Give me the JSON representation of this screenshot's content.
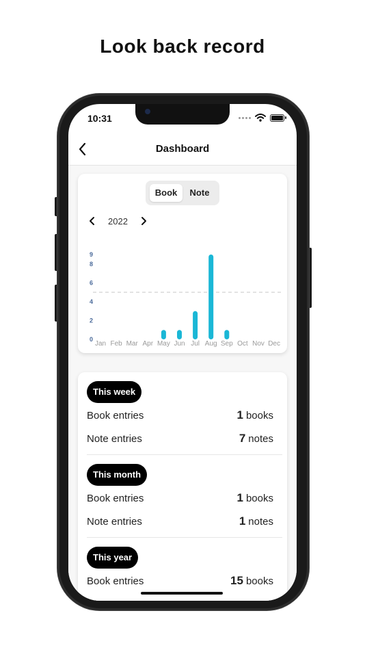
{
  "headline": "Look back record",
  "status": {
    "time": "10:31"
  },
  "nav": {
    "title": "Dashboard"
  },
  "segment": {
    "options": [
      "Book",
      "Note"
    ],
    "selected": "Book"
  },
  "year": "2022",
  "colors": {
    "bar": "#1ab7d6",
    "pill_bg": "#000000",
    "axis_label": "#4a6a9a"
  },
  "chart_data": {
    "type": "bar",
    "categories": [
      "Jan",
      "Feb",
      "Mar",
      "Apr",
      "May",
      "Jun",
      "Jul",
      "Aug",
      "Sep",
      "Oct",
      "Nov",
      "Dec"
    ],
    "values": [
      0,
      0,
      0,
      0,
      1,
      1,
      3,
      9,
      1,
      0,
      0,
      0
    ],
    "ytick_labels": [
      "0",
      "2",
      "4",
      "6",
      "8",
      "9"
    ],
    "ylim": [
      0,
      9
    ],
    "average_line": 5
  },
  "stats": {
    "week": {
      "label": "This week",
      "book_label": "Book entries",
      "book_value": "1",
      "book_unit": "books",
      "note_label": "Note entries",
      "note_value": "7",
      "note_unit": "notes"
    },
    "month": {
      "label": "This month",
      "book_label": "Book entries",
      "book_value": "1",
      "book_unit": "books",
      "note_label": "Note entries",
      "note_value": "1",
      "note_unit": "notes"
    },
    "year": {
      "label": "This year",
      "book_label": "Book entries",
      "book_value": "15",
      "book_unit": "books"
    }
  }
}
